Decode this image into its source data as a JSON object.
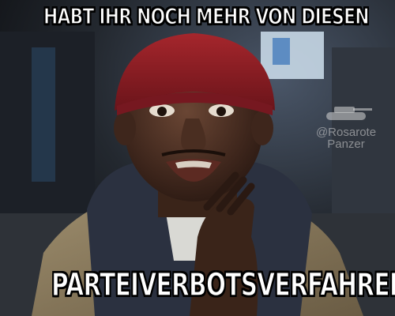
{
  "meme": {
    "top_caption": "HABT IHR NOCH MEHR VON DIESEN",
    "bottom_caption": "PARTEIVERBOTSVERFAHREN?",
    "watermark": {
      "handle": "@Rosarote",
      "name": "Panzer",
      "icon": "tank-icon"
    }
  },
  "colors": {
    "caption_fill": "#ffffff",
    "caption_outline": "#000000",
    "beanie": "#8e1e24",
    "jacket": "#8a7a5e",
    "hood": "#2b3140",
    "background_light": "#cfe0ee"
  }
}
